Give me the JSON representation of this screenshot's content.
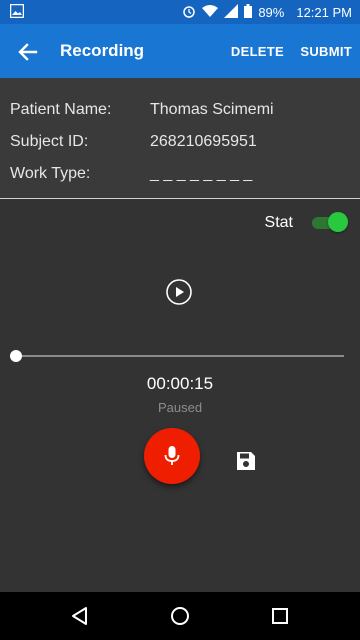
{
  "status_bar": {
    "battery": "89%",
    "time": "12:21 PM",
    "icons": [
      "image-icon",
      "alarm-icon",
      "wifi-icon",
      "signal-icon",
      "battery-icon"
    ]
  },
  "app_bar": {
    "title": "Recording",
    "delete_label": "DELETE",
    "submit_label": "SUBMIT",
    "background": "#1976D2"
  },
  "info": {
    "patient_label": "Patient Name:",
    "patient_value": "Thomas Scimemi",
    "subject_label": "Subject ID:",
    "subject_value": "268210695951",
    "work_type_label": "Work Type:",
    "work_type_value": "_ _ _ _ _ _ _ _"
  },
  "stat": {
    "label": "Stat",
    "enabled": true
  },
  "player": {
    "elapsed": "00:00:15",
    "state": "Paused",
    "progress": 0
  },
  "colors": {
    "accent_green": "#29C93F",
    "record_red": "#F01E00",
    "panel": "#333333"
  },
  "nav": [
    "back-icon",
    "home-icon",
    "recents-icon"
  ]
}
